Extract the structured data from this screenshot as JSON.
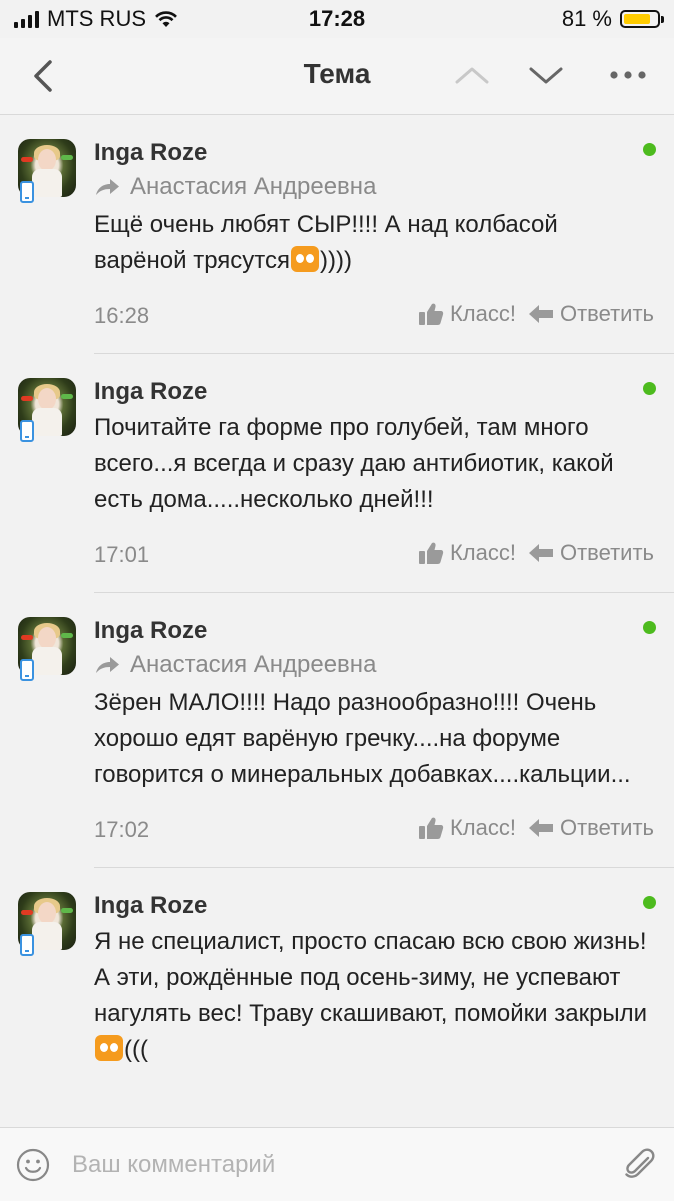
{
  "status_bar": {
    "carrier": "MTS RUS",
    "time": "17:28",
    "battery_percent_label": "81 %",
    "battery_level": 0.81
  },
  "nav": {
    "title": "Тема",
    "back_icon": "chevron-left-icon",
    "up_icon": "chevron-up-icon",
    "down_icon": "chevron-down-icon",
    "more_icon": "more-horizontal-icon"
  },
  "comments": [
    {
      "author": "Inga Roze",
      "reply_to": "Анастасия Андреевна",
      "text_before_emoji": "Ещё очень любят СЫР!!!! А над колбасой варёной трясутся",
      "text_after_emoji": "))))",
      "time": "16:28",
      "like_label": "Класс!",
      "reply_label": "Ответить"
    },
    {
      "author": "Inga Roze",
      "text": "Почитайте га форме про голубей, там много всего...я всегда и сразу даю антибиотик, какой есть дома.....несколько дней!!!",
      "time": "17:01",
      "like_label": "Класс!",
      "reply_label": "Ответить"
    },
    {
      "author": "Inga Roze",
      "reply_to": "Анастасия Андреевна",
      "text": "Зёрен МАЛО!!!! Надо разнообразно!!!! Очень хорошо едят варёную гречку....на форуме говорится о минеральных добавках....кальции...",
      "time": "17:02",
      "like_label": "Класс!",
      "reply_label": "Ответить"
    },
    {
      "author": "Inga Roze",
      "text_before_emoji": "Я не специалист, просто спасаю всю свою жизнь! А эти, рождённые под осень-зиму, не успевают нагулять вес! Траву скашивают, помойки закрыли",
      "text_after_emoji": "((("
    }
  ],
  "composer": {
    "placeholder": "Ваш комментарий",
    "emoji_icon": "smile-icon",
    "attach_icon": "paperclip-icon"
  },
  "colors": {
    "online": "#4dbb1e",
    "battery": "#ffcc00",
    "mobile_icon": "#3a92e0",
    "muted_text": "#8a8a8a"
  }
}
